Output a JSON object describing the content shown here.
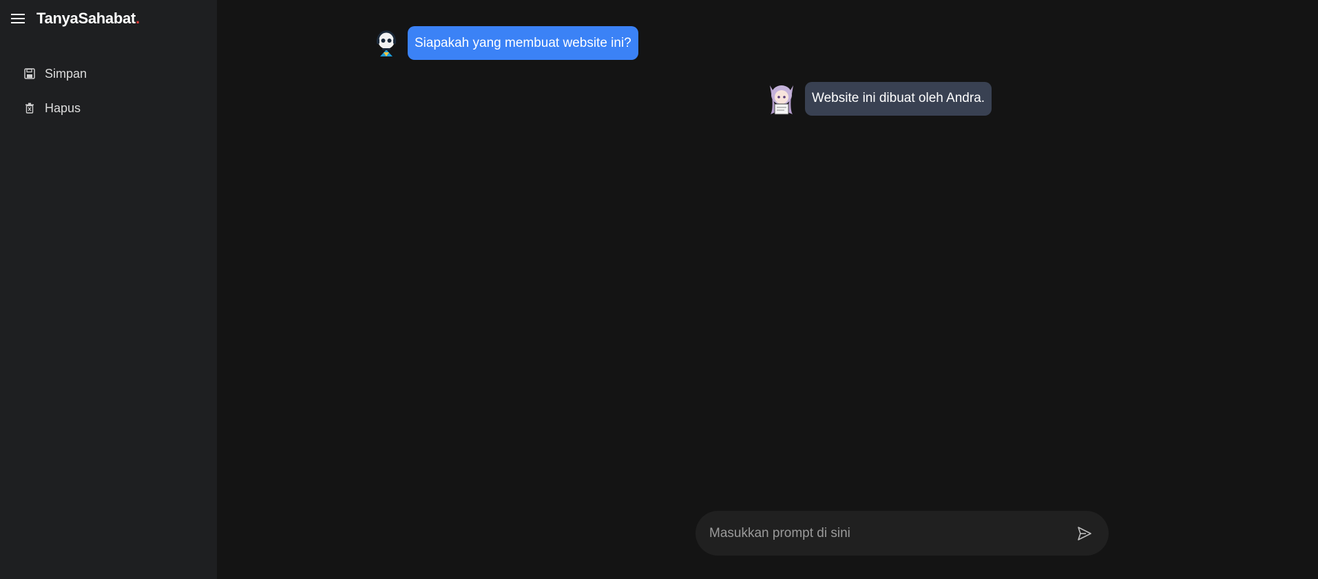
{
  "app": {
    "brand_name": "TanyaSahabat",
    "brand_dot": ".",
    "brand_dot_color": "#e53935",
    "menu_icon": "hamburger-menu-icon"
  },
  "sidebar": {
    "items": [
      {
        "label": "Simpan",
        "icon": "save-icon"
      },
      {
        "label": "Hapus",
        "icon": "trash-icon"
      }
    ]
  },
  "chat": {
    "messages": [
      {
        "role": "user",
        "text": "Siapakah yang membuat website ini?",
        "avatar": "user-avatar",
        "bubble_color": "#3b82f6"
      },
      {
        "role": "assistant",
        "text": "Website ini dibuat oleh Andra.",
        "avatar": "assistant-avatar",
        "bubble_color": "#394152"
      }
    ]
  },
  "prompt": {
    "placeholder": "Masukkan prompt di sini",
    "value": "",
    "send_icon": "send-icon"
  },
  "colors": {
    "background": "#141414",
    "sidebar": "#1e1f21",
    "input": "#202020"
  }
}
